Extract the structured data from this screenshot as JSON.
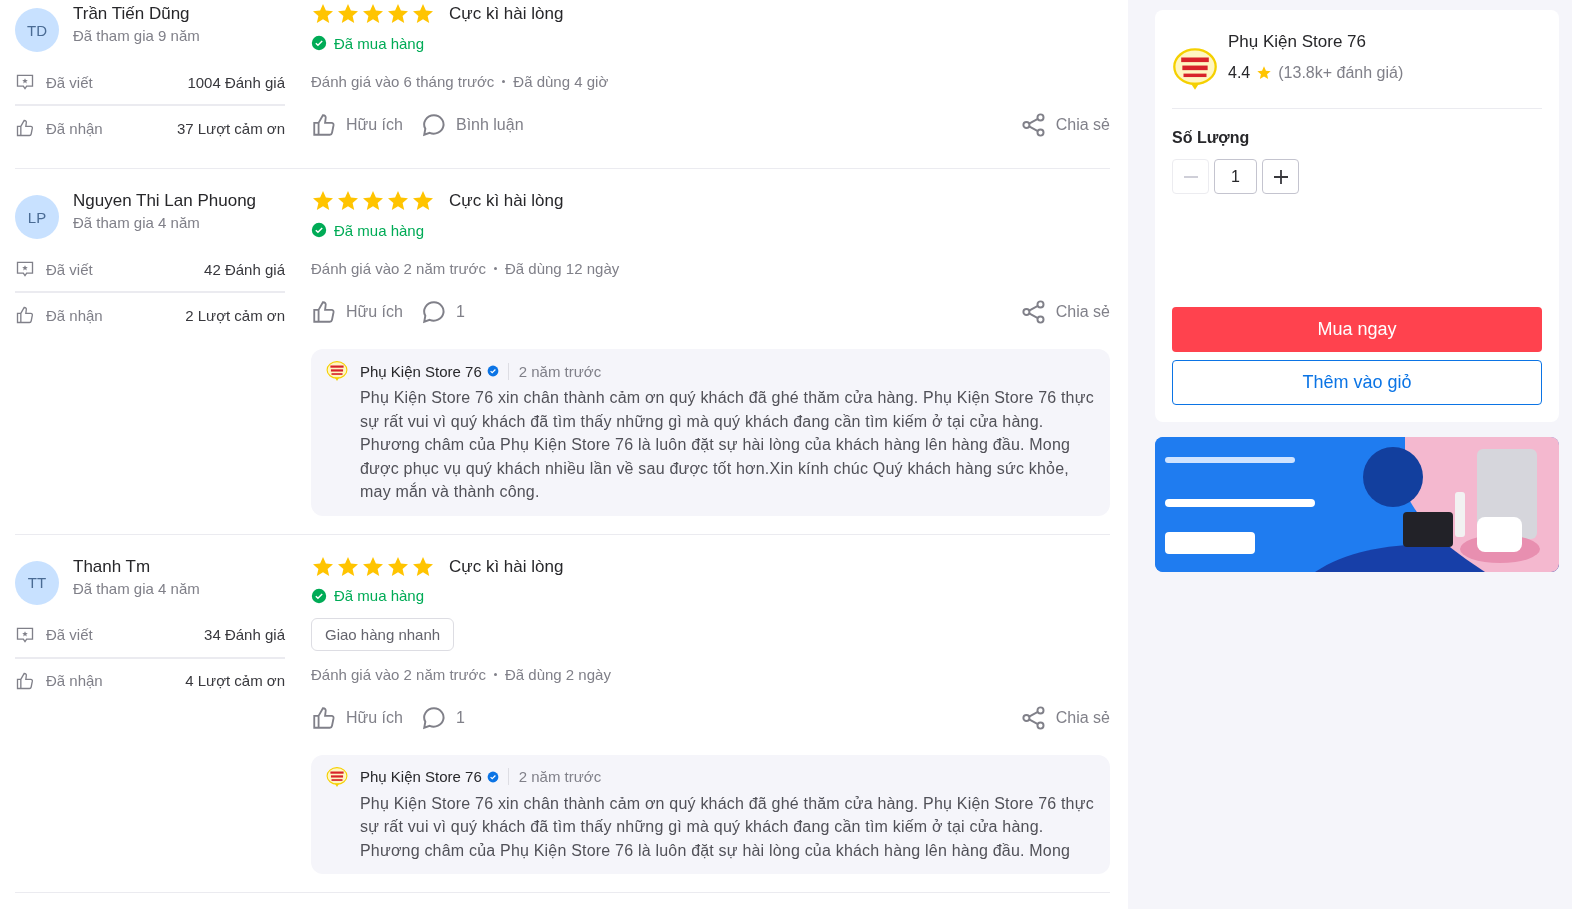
{
  "reviews": [
    {
      "initials": "TD",
      "name": "Trần Tiến Dũng",
      "joined": "Đã tham gia 9 năm",
      "written_label": "Đã viết",
      "written_value": "1004 Đánh giá",
      "received_label": "Đã nhận",
      "received_value": "37 Lượt cảm ơn",
      "stars": 5,
      "title": "Cực kì hài lòng",
      "purchase_badge": "Đã mua hàng",
      "reviewed": "Đánh giá vào 6 tháng trước",
      "used": "Đã dùng 4 giờ",
      "helpful": "Hữu ích",
      "comments": "Bình luận",
      "share": "Chia sẻ"
    },
    {
      "initials": "LP",
      "name": "Nguyen Thi Lan Phuong",
      "joined": "Đã tham gia 4 năm",
      "written_label": "Đã viết",
      "written_value": "42 Đánh giá",
      "received_label": "Đã nhận",
      "received_value": "2 Lượt cảm ơn",
      "stars": 5,
      "title": "Cực kì hài lòng",
      "purchase_badge": "Đã mua hàng",
      "reviewed": "Đánh giá vào 2 năm trước",
      "used": "Đã dùng 12 ngày",
      "helpful": "Hữu ích",
      "comments": "1",
      "share": "Chia sẻ",
      "reply": {
        "shop": "Phụ Kiện Store 76",
        "time": "2 năm trước",
        "text": "Phụ Kiện Store 76 xin chân thành cảm ơn quý khách đã ghé thăm cửa hàng. Phụ Kiện Store 76 thực sự rất vui vì quý khách đã tìm thấy những gì mà quý khách đang cần tìm kiếm ở tại cửa hàng. Phương châm của Phụ Kiện Store 76 là luôn đặt sự hài lòng của khách hàng lên hàng đầu. Mong được phục vụ quý khách nhiều lần về sau được tốt hơn.Xin kính chúc Quý khách hàng sức khỏe, may mắn và thành công."
      }
    },
    {
      "initials": "TT",
      "name": "Thanh Tm",
      "joined": "Đã tham gia 4 năm",
      "written_label": "Đã viết",
      "written_value": "34 Đánh giá",
      "received_label": "Đã nhận",
      "received_value": "4 Lượt cảm ơn",
      "stars": 5,
      "title": "Cực kì hài lòng",
      "purchase_badge": "Đã mua hàng",
      "tags": [
        "Giao hàng nhanh"
      ],
      "reviewed": "Đánh giá vào 2 năm trước",
      "used": "Đã dùng 2 ngày",
      "helpful": "Hữu ích",
      "comments": "1",
      "share": "Chia sẻ",
      "reply": {
        "shop": "Phụ Kiện Store 76",
        "time": "2 năm trước",
        "text": "Phụ Kiện Store 76 xin chân thành cảm ơn quý khách đã ghé thăm cửa hàng. Phụ Kiện Store 76 thực sự rất vui vì quý khách đã tìm thấy những gì mà quý khách đang cần tìm kiếm ở tại cửa hàng. Phương châm của Phụ Kiện Store 76 là luôn đặt sự hài lòng của khách hàng lên hàng đầu. Mong"
      }
    }
  ],
  "shop": {
    "name": "Phụ Kiện Store 76",
    "rating": "4.4",
    "reviews": "(13.8k+ đánh giá)"
  },
  "quantity": {
    "label": "Số Lượng",
    "value": "1",
    "decrease_disabled": true
  },
  "buttons": [
    {
      "kind": "primary",
      "label": "Mua ngay"
    },
    {
      "kind": "outline",
      "label": "Thêm vào giỏ"
    }
  ]
}
